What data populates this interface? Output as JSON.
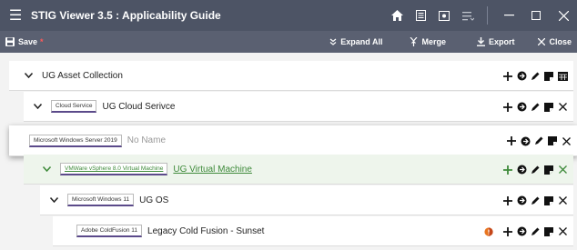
{
  "window": {
    "title": "STIG Viewer 3.5 : Applicability Guide",
    "menu_icon": "hamburger-icon",
    "controls": [
      "home-icon",
      "document-icon",
      "image-icon",
      "list-icon"
    ],
    "window_buttons": [
      "minimize-icon",
      "maximize-icon",
      "close-icon"
    ]
  },
  "toolbar": {
    "save_label": "Save",
    "unsaved_marker": "*",
    "expand_all_label": "Expand All",
    "merge_label": "Merge",
    "export_label": "Export",
    "close_label": "Close"
  },
  "tree": [
    {
      "tag": "",
      "name": "UG Asset Collection",
      "expanded": true,
      "actions": [
        "add",
        "copy",
        "edit",
        "note",
        "table"
      ]
    },
    {
      "tag": "Cloud Service",
      "name": "UG Cloud Serivce",
      "expanded": true,
      "actions": [
        "add",
        "copy",
        "edit",
        "note",
        "close"
      ]
    },
    {
      "tag": "Microsoft Windows Server 2019",
      "name": "No Name",
      "placeholder": true,
      "actions": [
        "add",
        "copy",
        "edit",
        "note",
        "close"
      ]
    },
    {
      "tag": "VMWare vSphere 8.0 Virtual Machine",
      "name": "UG Virtual Machine",
      "expanded": true,
      "highlighted": true,
      "actions": [
        "add",
        "copy",
        "edit",
        "note",
        "close"
      ]
    },
    {
      "tag": "Microsoft Windows 11",
      "name": "UG OS",
      "expanded": true,
      "actions": [
        "add",
        "copy",
        "edit",
        "note",
        "close"
      ]
    },
    {
      "tag": "Adobe ColdFusion 11",
      "name": "Legacy Cold Fusion - Sunset",
      "warning": true,
      "actions": [
        "add",
        "copy",
        "edit",
        "note",
        "close"
      ]
    }
  ],
  "colors": {
    "titlebar": "#4d5465",
    "toolbar": "#5a6071",
    "tag_underline": "#5b4a8a",
    "highlight_green": "#3e8a3a",
    "warning_orange": "#e8741e",
    "unsaved_red": "#ff5a5a"
  }
}
